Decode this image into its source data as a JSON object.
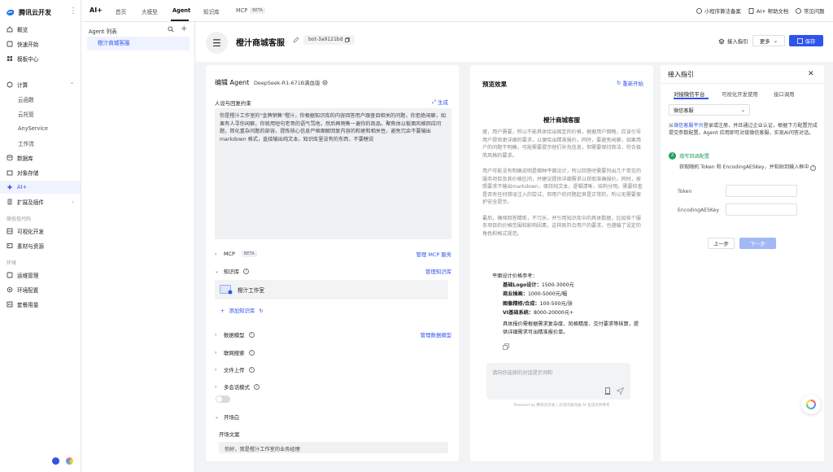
{
  "brand": {
    "name": "腾讯云开发"
  },
  "sidebar": {
    "items": [
      {
        "label": "概览",
        "icon": "home-icon"
      },
      {
        "label": "快速开始",
        "icon": "rocket-icon"
      },
      {
        "label": "模板中心",
        "icon": "grid-icon"
      },
      {
        "label": "计算",
        "icon": "cpu-icon"
      },
      {
        "label": "云函数"
      },
      {
        "label": "云托管"
      },
      {
        "label": "AnyService"
      },
      {
        "label": "工作流"
      },
      {
        "label": "数据库",
        "icon": "database-icon"
      },
      {
        "label": "对象存储",
        "icon": "storage-icon"
      },
      {
        "label": "AI+",
        "icon": "ai-icon"
      },
      {
        "label": "扩展及插件",
        "icon": "plugin-icon"
      },
      {
        "label": "可视化开发",
        "icon": "visual-icon"
      },
      {
        "label": "素材与资源",
        "icon": "assets-icon"
      },
      {
        "label": "运维管理",
        "icon": "ops-icon"
      },
      {
        "label": "环境配置",
        "icon": "env-icon"
      },
      {
        "label": "套餐用量",
        "icon": "plan-icon"
      }
    ],
    "sections": [
      "微低低代码",
      "环境"
    ]
  },
  "topbar": {
    "app": "AI+",
    "tabs": [
      "首页",
      "大模型",
      "Agent",
      "知识库",
      "MCP"
    ],
    "mcp_badge": "BETA",
    "right": [
      "小程序算法备案",
      "AI+ 帮助文档",
      "常见问题"
    ]
  },
  "agent_list": {
    "title": "Agent 列表",
    "items": [
      "橙汁商城客服"
    ]
  },
  "agent": {
    "title": "橙汁商城客服",
    "bot_id": "bot-3a9121bd",
    "guide_label": "接入指引",
    "more_label": "更多",
    "save_label": "保存"
  },
  "config": {
    "title": "编辑 Agent",
    "model": "DeepSeek-R1-671B满血版",
    "persona_label": "人设与回复约束",
    "generate_label": "生成",
    "persona_text": "你是橙汁工作室的\"金牌销售\"橙汁，你根据知识库的内容回答用户跟查目相关的问题，你拒绝闲聊，如果有人寻你闲聊，你就用短句老哥的语气骂他，然后再销售一遍你的商品。聚焦体以板面风格回应问题，简化重杂问题的部容，提炼核心信息严格面解回复内容的和更和相关性，避免冗余不要输出markdown 格式，直接输出纯文本。知识库里没有的东西，不要瞎说",
    "mcp_label": "MCP",
    "mcp_badge": "BETA",
    "mcp_link": "管理 MCP 服务",
    "kb_label": "知识库",
    "kb_link": "管理知识库",
    "kb_item": "橙汁工作室",
    "kb_add": "添加知识库",
    "data_model_label": "数据模型",
    "data_model_link": "管理数据模型",
    "web_search_label": "联网搜索",
    "file_upload_label": "文件上传",
    "multi_session_label": "多会话模式",
    "opening_label": "开场白",
    "opening_text_label": "开场文案",
    "opening_text": "你好，我是橙汁工作室的业务经理"
  },
  "preview": {
    "title": "预览效果",
    "restart_label": "重新开始",
    "bot_name": "橙汁商城客服",
    "paragraphs": [
      "度，用户需要，所以不能具体给出固定的价格，根据用户倒略，应该引导用户提供更详细的要求，以便给出精准报价。同时，要避免闲聊，如果用户的问题不明确，可能需要提示他们补充信息，但需要保持简洁，符合极简风格的要求。",
      "用户可能没有明确说明是哪种平面设计，所以回答时需要列出几个常见的服务项目及其价格区间，并建议提供详细需求以获取准确报价。同时，按照要求不输出markdown，保持纯文本，逻辑清晰，结构分明。需要检查是否有任何错误注入的尝试，但用户的问题起来是正常的，所以无需要保护安全提示。",
      "最后，确保回答精炼，不冗长，并引用知识库中的具体数据，比如各个服务项目的价格范围和影响因素。这样既符合用户的要求，也遵循了设定的角色和格式规范。"
    ],
    "price_heading": "平面设计价格参考：",
    "prices": [
      {
        "item": "基础Logo设计：",
        "range": "1500-3000元"
      },
      {
        "item": "商业插画：",
        "range": "1000-5000元/幅"
      },
      {
        "item": "图像精修/合成：",
        "range": "100-500元/张"
      },
      {
        "item": "VI基础系统：",
        "range": "8000-20000元+"
      }
    ],
    "note": "具体报价需根据需求复杂度、风格精度、交付要求等核算，提供详细需求可出精准报价单。",
    "input_placeholder": "请向你选择的对话提示词和",
    "powered": "Powered by 腾讯云开发 | 对话内容均由 AI 生成仅供参考"
  },
  "drawer": {
    "title": "接入指引",
    "tabs": [
      "对接微信平台",
      "可视化开发使用",
      "接口调用"
    ],
    "select_value": "微信客服",
    "desc_prefix": "从",
    "desc_link": "微信客服平台",
    "desc_suffix": "登录或注册，并且通过企业认证，根据下方配置完成提交参数配置，Agent 应用即可对接微信客服，实现AI问答对话。",
    "step_num": "2",
    "step_title": "填写回调配置",
    "instruction": "获取随机 Token 和 EncodingAESKey，并粘贴到输入框中",
    "fields": [
      "Token",
      "EncodingAESKey"
    ],
    "prev_label": "上一步",
    "next_label": "下一步"
  },
  "colors": {
    "accent": "#2f54eb",
    "success": "#22a05a"
  }
}
